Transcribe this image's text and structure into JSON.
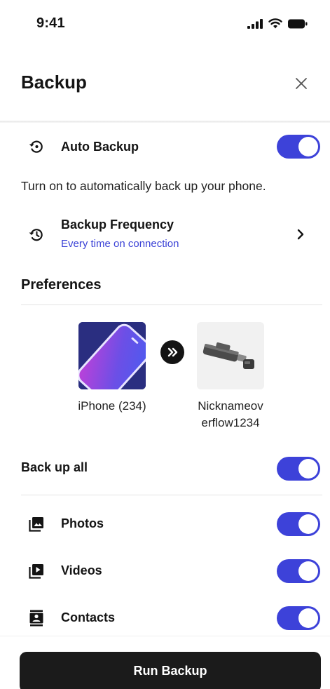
{
  "status_bar": {
    "time": "9:41",
    "icons": [
      "cellular-signal-icon",
      "wifi-icon",
      "battery-icon"
    ]
  },
  "header": {
    "title": "Backup",
    "close_icon": "close-icon"
  },
  "auto_backup": {
    "label": "Auto Backup",
    "icon": "restore-clock-icon",
    "enabled": true,
    "description": "Turn on to automatically back up your phone."
  },
  "frequency": {
    "label": "Backup Frequency",
    "value": "Every time on connection",
    "icon": "history-icon"
  },
  "preferences": {
    "title": "Preferences",
    "source_device": "iPhone (234)",
    "target_device": "Nicknameov\nerflow1234"
  },
  "backup_all": {
    "label": "Back up all",
    "enabled": true
  },
  "items": [
    {
      "label": "Photos",
      "icon": "photo-library-icon",
      "enabled": true
    },
    {
      "label": "Videos",
      "icon": "video-library-icon",
      "enabled": true
    },
    {
      "label": "Contacts",
      "icon": "contacts-icon",
      "enabled": true
    }
  ],
  "run_button": {
    "label": "Run Backup"
  },
  "colors": {
    "accent": "#3d42d9",
    "link": "#3b42d6",
    "button_bg": "#1b1b1b"
  }
}
